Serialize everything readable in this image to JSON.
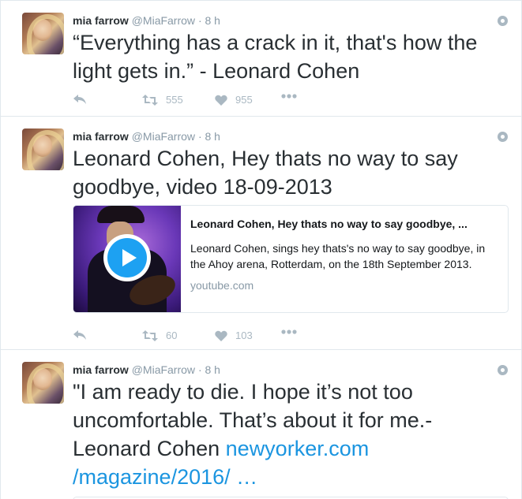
{
  "tweets": [
    {
      "fullname": "mia farrow",
      "handle": "@MiaFarrow",
      "dot": "·",
      "time": "8 h",
      "text": "“Everything has a crack in it,  that's how the light gets in.” - Leonard Cohen",
      "retweets": "555",
      "likes": "955"
    },
    {
      "fullname": "mia farrow",
      "handle": "@MiaFarrow",
      "dot": "·",
      "time": "8 h",
      "text": "Leonard Cohen, Hey thats no way to say goodbye, video 18-09-2013",
      "card": {
        "title": "Leonard Cohen, Hey thats no way to say goodbye, ...",
        "description": "Leonard Cohen, sings hey thats's no way to say goodbye, in the Ahoy arena, Rotterdam, on the 18th September 2013.",
        "domain": "youtube.com"
      },
      "retweets": "60",
      "likes": "103"
    },
    {
      "fullname": "mia farrow",
      "handle": "@MiaFarrow",
      "dot": "·",
      "time": "8 h",
      "text": "\"I am ready to die. I hope it’s not too uncomfortable. That’s about it for me.-Leonard Cohen ",
      "link": "newyorker.com /magazine/2016/ …"
    }
  ],
  "icons": {
    "reply": "reply-icon",
    "retweet": "retweet-icon",
    "like": "heart-icon",
    "more": "more-icon",
    "gear": "globe-icon",
    "play": "play-icon"
  },
  "colors": {
    "text": "#292f33",
    "secondary": "#8899a6",
    "action": "#aab8c2",
    "link": "#1b95e0",
    "border": "#e1e8ed",
    "play": "#1da1f2"
  }
}
